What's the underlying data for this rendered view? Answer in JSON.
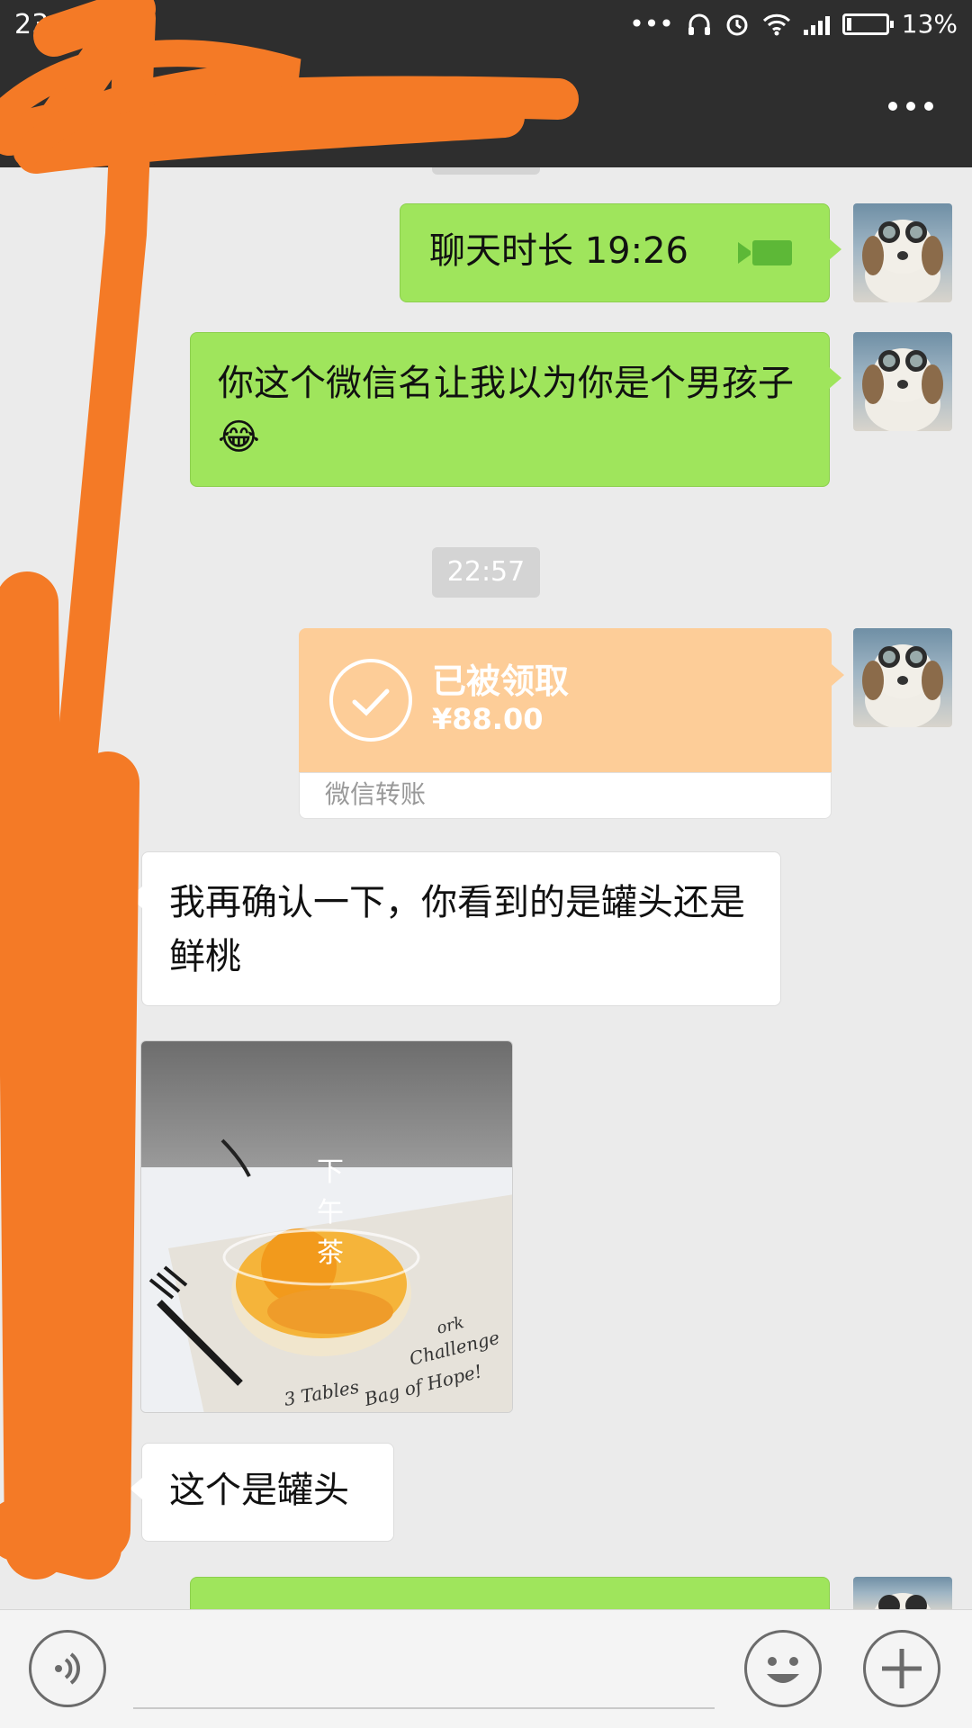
{
  "status_bar": {
    "time": "23:0",
    "battery_percent": "13%",
    "battery_level": 0.13,
    "icons": [
      "more-dots-icon",
      "headphones-icon",
      "alarm-icon",
      "wifi-icon",
      "signal-icon",
      "battery-icon"
    ]
  },
  "nav": {
    "more_icon": "more-icon"
  },
  "messages": [
    {
      "id": "m1",
      "side": "sent",
      "text": "聊天时长 19:26",
      "icon": "video-call-icon"
    },
    {
      "id": "m2",
      "side": "sent",
      "text": "你这个微信名让我以为你是个男孩子😂"
    },
    {
      "id": "t1",
      "type": "timestamp",
      "text": "22:57"
    },
    {
      "id": "m3",
      "side": "sent",
      "type": "transfer",
      "status": "已被领取",
      "amount": "¥88.00",
      "footer": "微信转账"
    },
    {
      "id": "m4",
      "side": "received",
      "text": "我再确认一下，你看到的是罐头还是鲜桃"
    },
    {
      "id": "m5",
      "side": "received",
      "type": "image",
      "image_caption_text": [
        "下",
        "午",
        "茶"
      ],
      "image_printed_text": [
        "3 Tables",
        "Challenge",
        "Bag of Hope!",
        "ork"
      ]
    },
    {
      "id": "m6",
      "side": "received",
      "text": "这个是罐头"
    }
  ],
  "input_bar": {
    "voice_icon": "voice-icon",
    "emoji_icon": "emoji-icon",
    "plus_icon": "plus-icon"
  },
  "colors": {
    "sent_bubble": "#9fe55c",
    "received_bubble": "#ffffff",
    "transfer": "#fdcd98",
    "header": "#2e2e2e",
    "background": "#ebebeb",
    "scribble": "#f47a26"
  }
}
